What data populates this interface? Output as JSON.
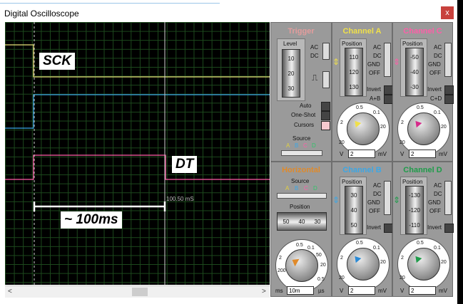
{
  "window": {
    "title": "Digital Oscilloscope",
    "close_label": "x"
  },
  "scope": {
    "annotations": {
      "sck": "SCK",
      "dt": "DT",
      "interval": "~ 100ms"
    },
    "cursor_readout": "100.50 mS",
    "colors": {
      "channel_a": "#e9e17a",
      "channel_b": "#3ba7e6",
      "channel_c": "#ff5ea8",
      "channel_d": "#32c46a",
      "cursor": "#ffffff",
      "grid": "#1d4a1d"
    }
  },
  "scrollbar": {
    "left_arrow": "<",
    "right_arrow": ">"
  },
  "trigger": {
    "title": "Trigger",
    "level_label": "Level",
    "level_ticks": [
      "10",
      "20",
      "30"
    ],
    "coupling": [
      "AC",
      "DC"
    ],
    "modes": [
      "Auto",
      "One-Shot",
      "Cursors"
    ],
    "source_label": "Source",
    "source_options": [
      "A",
      "B",
      "C",
      "D"
    ]
  },
  "horizontal": {
    "title": "Horizontal",
    "source_label": "Source",
    "source_options": [
      "A",
      "B",
      "C",
      "D"
    ],
    "position_label": "Position",
    "position_ticks": [
      "50",
      "40",
      "30"
    ],
    "dial_ticks": [
      "0.5",
      "0.2",
      "0.1",
      "50",
      "20",
      "10",
      "5",
      "2",
      "1",
      "200",
      "100",
      "50",
      "20",
      "10",
      "5",
      "2",
      "1",
      "0.5"
    ],
    "unit_left": "ms",
    "unit_right": "µs",
    "value": "10m"
  },
  "channel_a": {
    "title": "Channel A",
    "position_label": "Position",
    "position_ticks": [
      "110",
      "120",
      "130"
    ],
    "coupling": [
      "AC",
      "DC",
      "GND",
      "OFF"
    ],
    "buttons": [
      "Invert",
      "A+B"
    ],
    "dial_ticks": [
      "0.5",
      "0.2",
      "0.1",
      "50",
      "20",
      "10",
      "5",
      "2",
      "1",
      "20"
    ],
    "unit_left": "V",
    "unit_right": "mV",
    "value": "2"
  },
  "channel_b": {
    "title": "Channel B",
    "position_label": "Position",
    "position_ticks": [
      "30",
      "40",
      "50"
    ],
    "coupling": [
      "AC",
      "DC",
      "GND",
      "OFF"
    ],
    "buttons": [
      "Invert"
    ],
    "dial_ticks": [
      "0.5",
      "0.2",
      "0.1",
      "50",
      "20",
      "10",
      "5",
      "2",
      "1",
      "20"
    ],
    "unit_left": "V",
    "unit_right": "mV",
    "value": "2"
  },
  "channel_c": {
    "title": "Channel C",
    "position_label": "Position",
    "position_ticks": [
      "-50",
      "-40",
      "-30"
    ],
    "coupling": [
      "AC",
      "DC",
      "GND",
      "OFF"
    ],
    "buttons": [
      "Invert",
      "C+D"
    ],
    "dial_ticks": [
      "0.5",
      "0.2",
      "0.1",
      "50",
      "20",
      "10",
      "5",
      "2",
      "1",
      "20"
    ],
    "unit_left": "V",
    "unit_right": "mV",
    "value": "2"
  },
  "channel_d": {
    "title": "Channel D",
    "position_label": "Position",
    "position_ticks": [
      "-130",
      "-120",
      "-110"
    ],
    "coupling": [
      "AC",
      "DC",
      "GND",
      "OFF"
    ],
    "buttons": [
      "Invert"
    ],
    "dial_ticks": [
      "0.5",
      "0.2",
      "0.1",
      "50",
      "20",
      "10",
      "5",
      "2",
      "1",
      "20"
    ],
    "unit_left": "V",
    "unit_right": "mV",
    "value": "2"
  }
}
